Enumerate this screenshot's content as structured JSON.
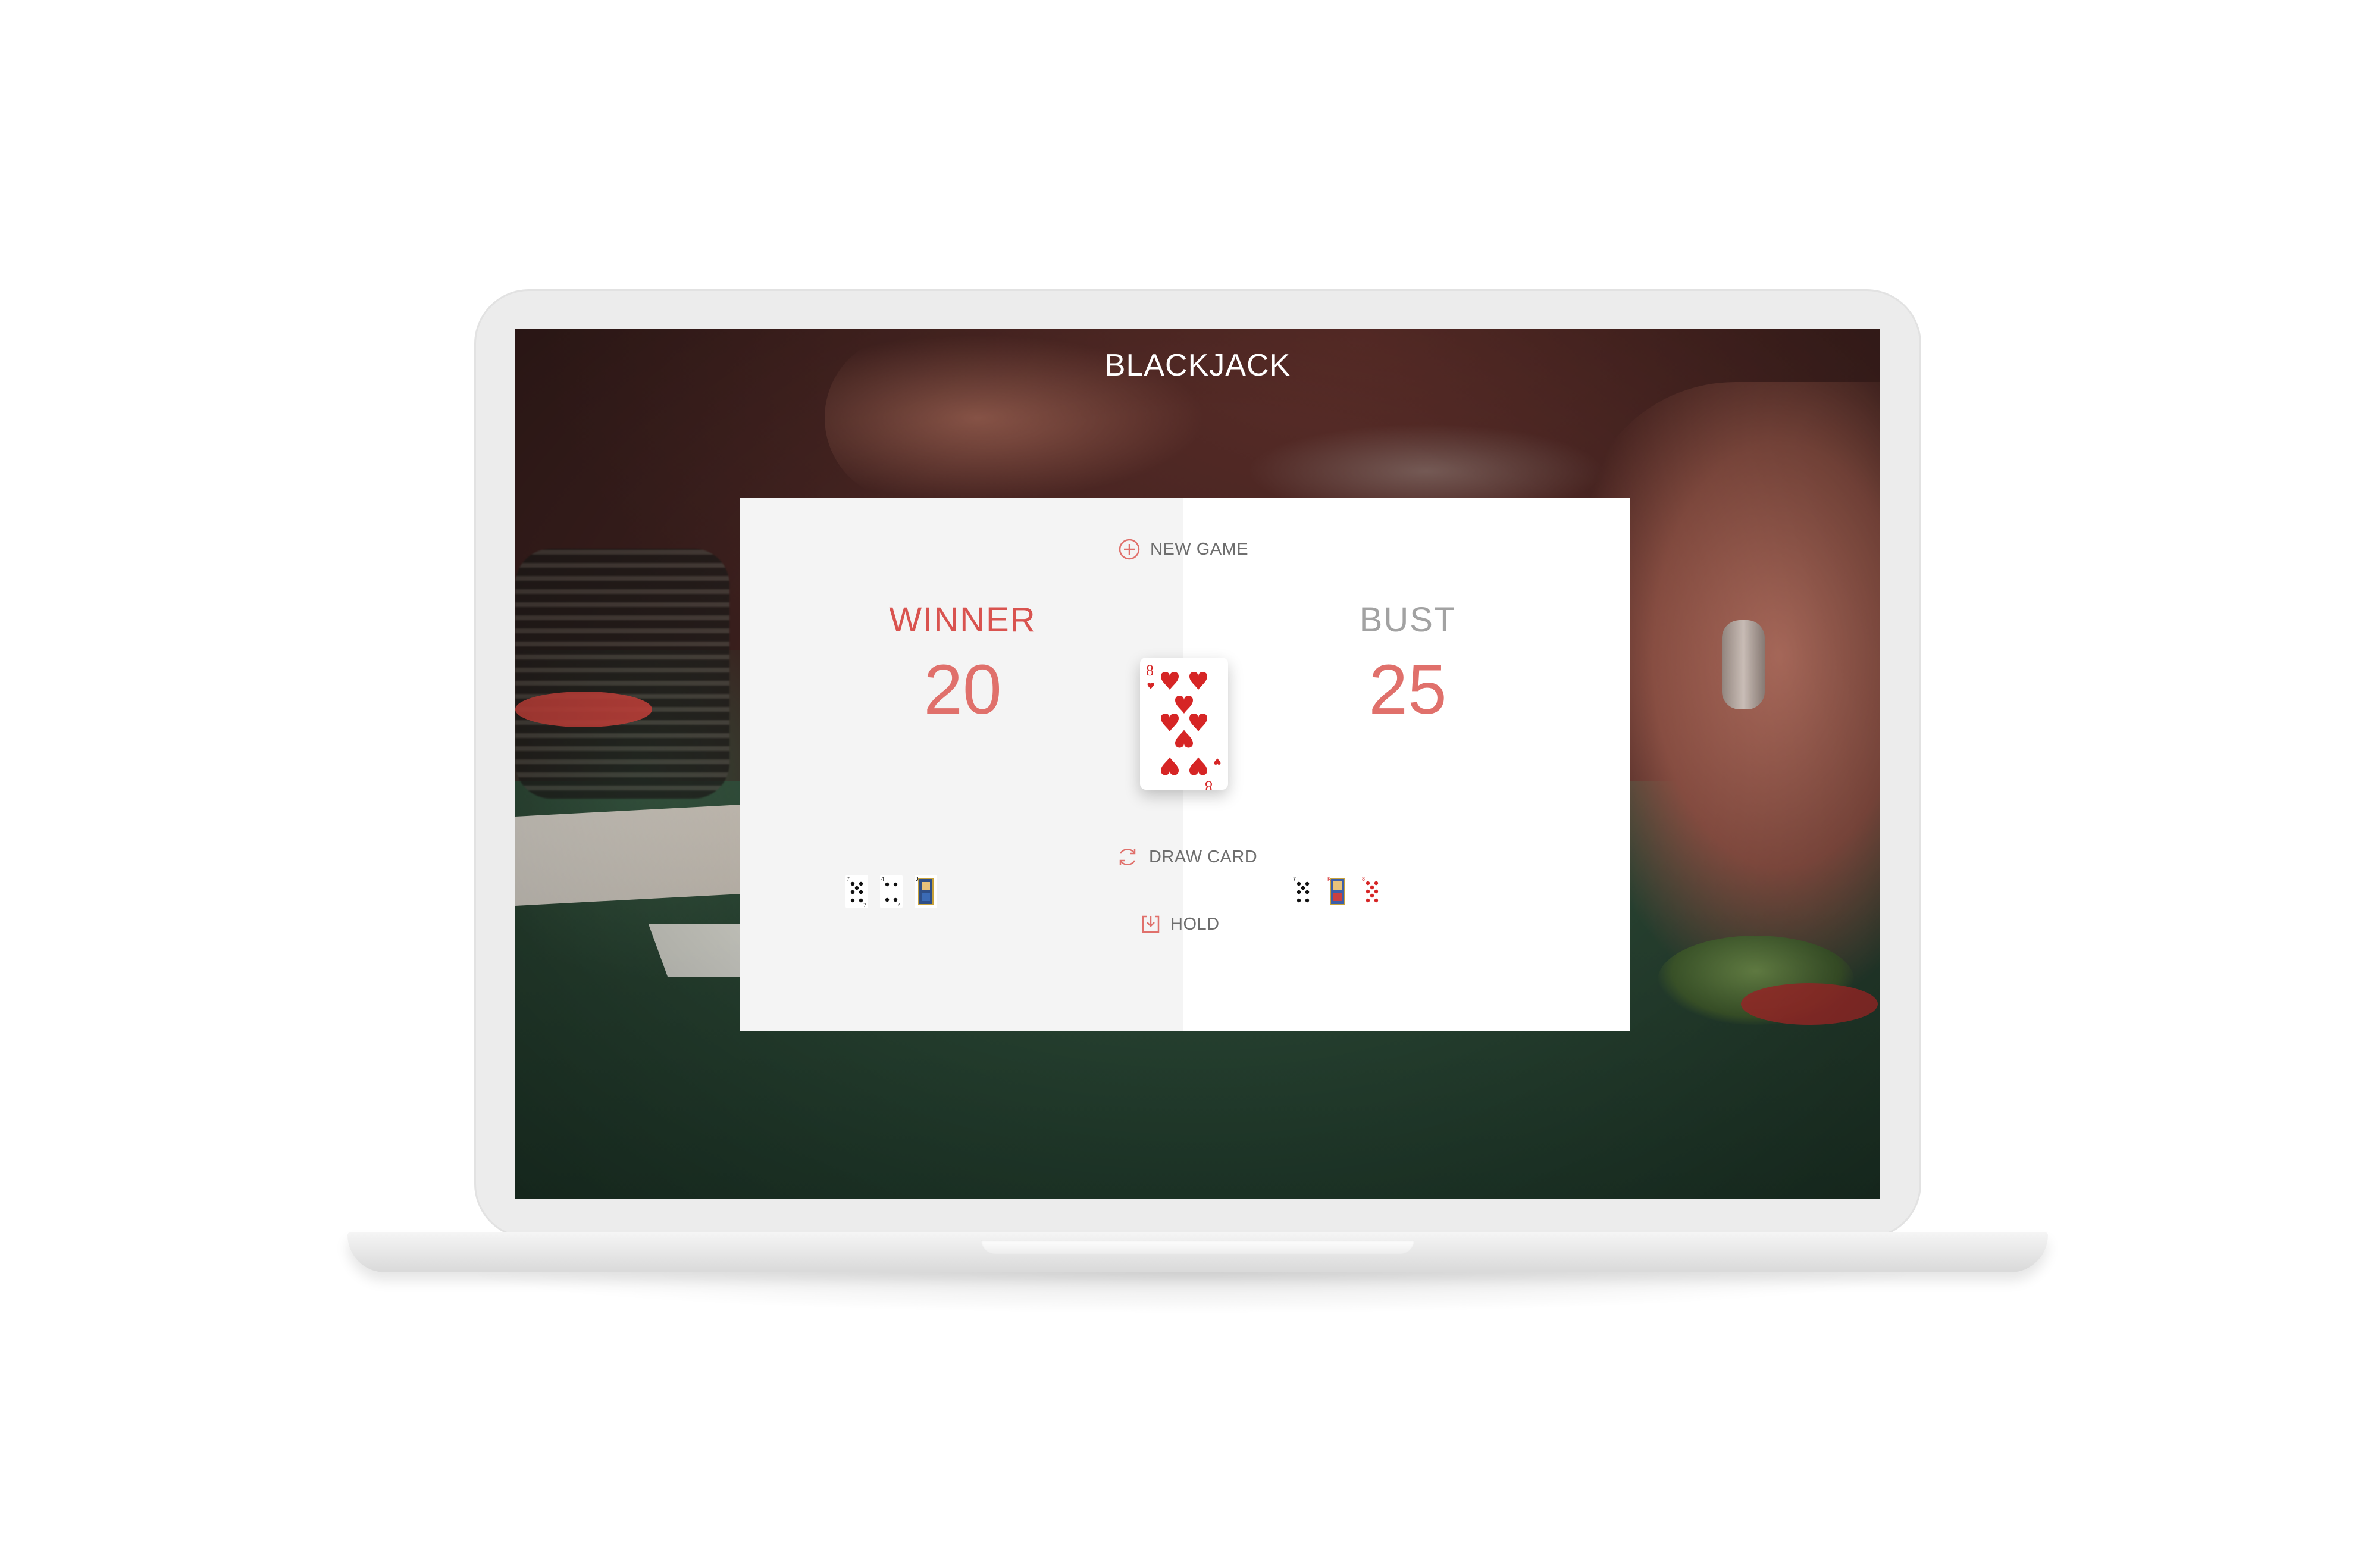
{
  "app": {
    "title": "BLACKJACK"
  },
  "actions": {
    "new_game": "NEW GAME",
    "draw_card": "DRAW CARD",
    "hold": "HOLD"
  },
  "players": [
    {
      "status": "WINNER",
      "score": "20",
      "status_color": "#d9534f",
      "hand": [
        {
          "rank": "7",
          "suit": "spades"
        },
        {
          "rank": "4",
          "suit": "spades"
        },
        {
          "rank": "J",
          "suit": "spades"
        }
      ]
    },
    {
      "status": "BUST",
      "score": "25",
      "status_color": "#a2a2a2",
      "hand": [
        {
          "rank": "7",
          "suit": "spades"
        },
        {
          "rank": "K",
          "suit": "hearts"
        },
        {
          "rank": "8",
          "suit": "hearts"
        }
      ]
    }
  ],
  "drawn_card": {
    "rank": "8",
    "suit": "hearts"
  },
  "colors": {
    "accent": "#e0706b",
    "text_muted": "#6e6e6e"
  }
}
